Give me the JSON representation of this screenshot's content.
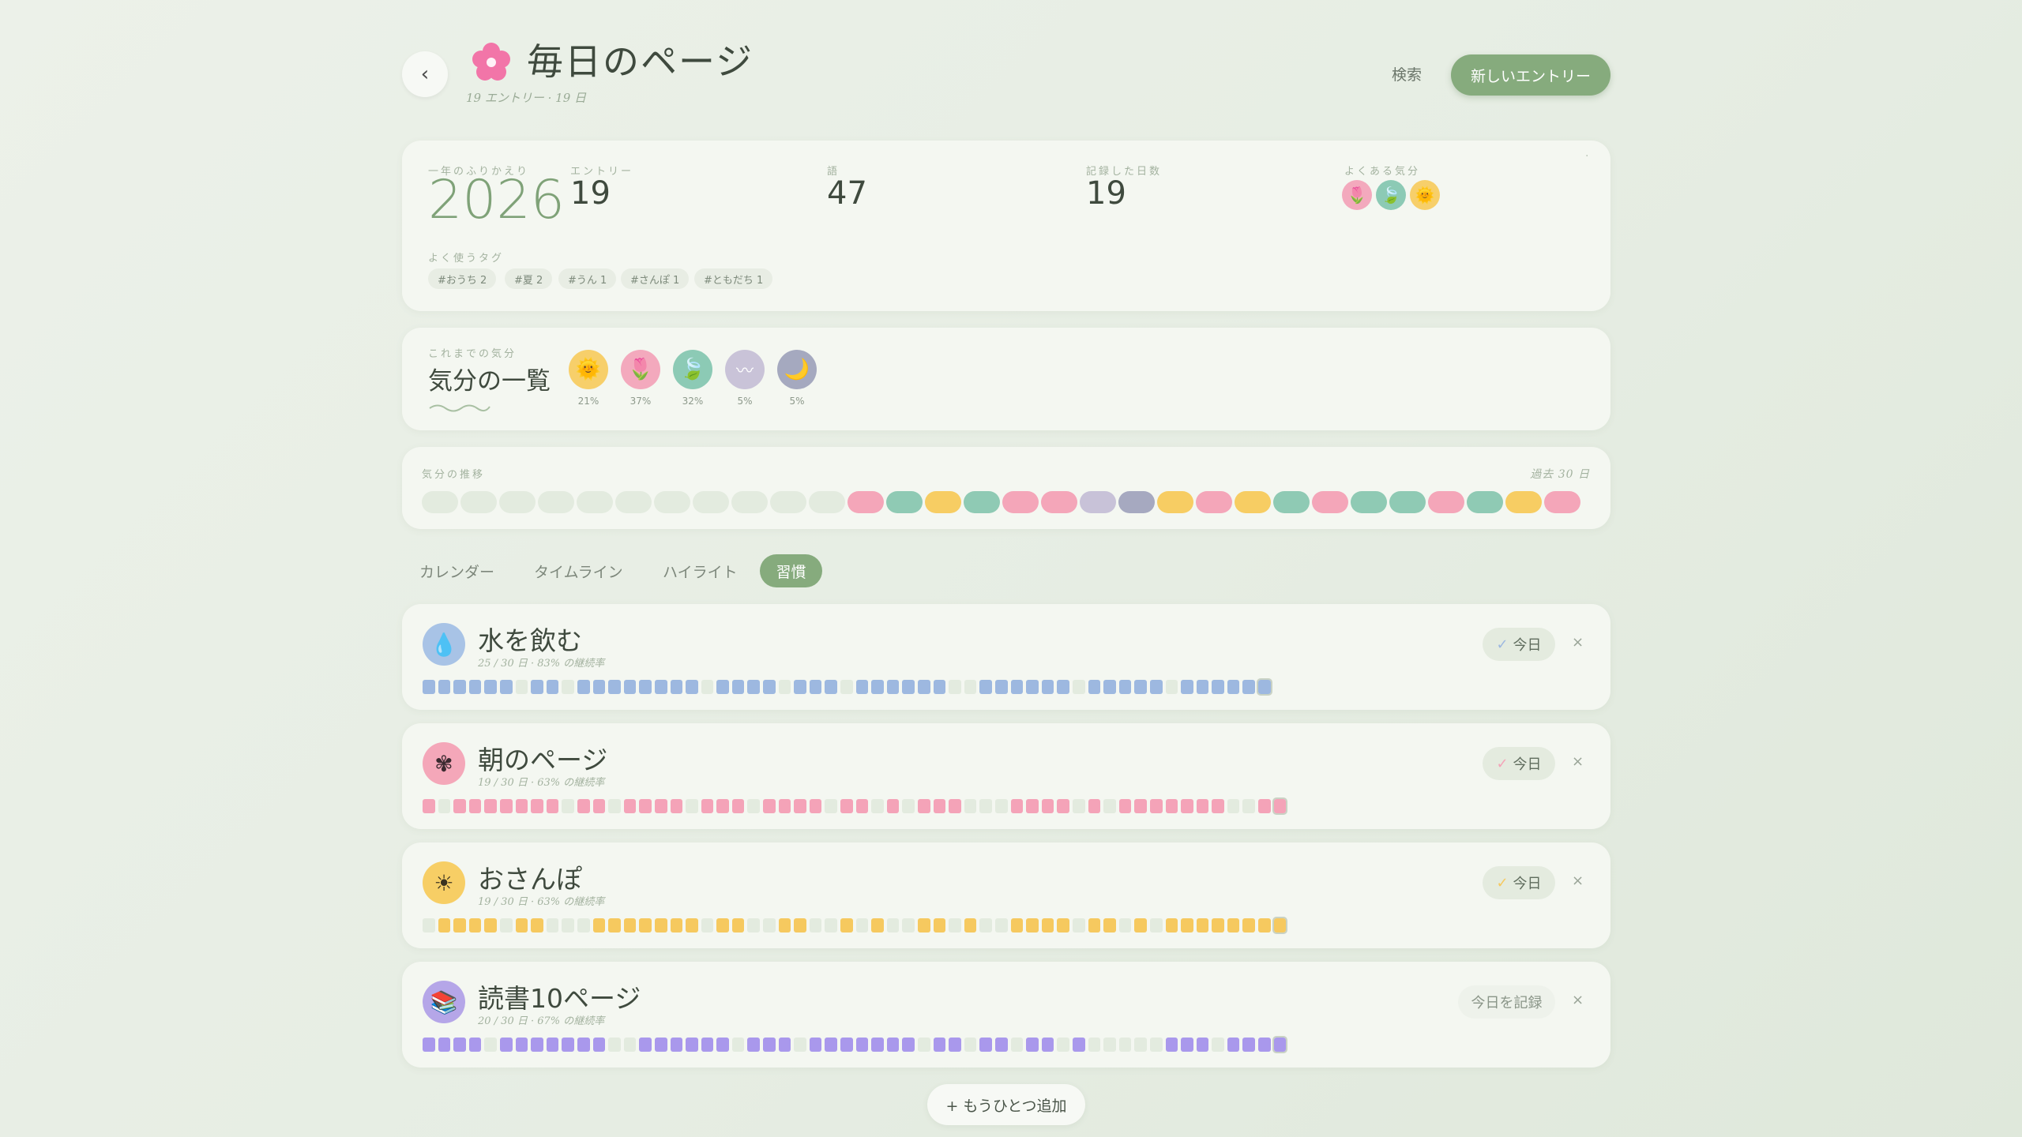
{
  "header": {
    "title": "毎日のページ",
    "subtitle": "19 エントリー · 19 日",
    "search_label": "検索",
    "new_entry_label": "新しいエントリー",
    "title_icon": "flower-icon",
    "back_icon": "chevron-left-icon"
  },
  "year_review": {
    "label": "一年のふりかえり",
    "year": "2026",
    "entries_label": "エントリー",
    "entries_value": "19",
    "words_label": "語",
    "words_value": "47",
    "days_label": "記録した日数",
    "days_value": "19",
    "common_moods_label": "よくある気分",
    "common_moods": [
      "tulip-icon",
      "leaf-icon",
      "sun-icon"
    ],
    "corner_mark": "·",
    "tags_label": "よく使うタグ",
    "tags": [
      "#おうち 2",
      "#夏 2",
      "#うん 1",
      "#さんぽ 1",
      "#ともだち 1"
    ]
  },
  "mood_overview": {
    "label": "これまでの気分",
    "title": "気分の一覧",
    "moods": [
      {
        "icon": "sun-icon",
        "glyph": "🌞",
        "pct": "21%",
        "color": "#f7cf6a"
      },
      {
        "icon": "tulip-icon",
        "glyph": "🌷",
        "pct": "37%",
        "color": "#f3a9bd"
      },
      {
        "icon": "leaf-icon",
        "glyph": "🍃",
        "pct": "32%",
        "color": "#8ccab5"
      },
      {
        "icon": "cloud-icon",
        "glyph": "〰",
        "pct": "5%",
        "color": "#c9c3d8"
      },
      {
        "icon": "moon-icon",
        "glyph": "🌙",
        "pct": "5%",
        "color": "#a5a9bf"
      }
    ]
  },
  "mood_trend": {
    "label": "気分の推移",
    "range_label": "過去 30 日",
    "days": [
      "empty",
      "empty",
      "empty",
      "empty",
      "empty",
      "empty",
      "empty",
      "empty",
      "empty",
      "empty",
      "empty",
      "pink",
      "teal",
      "yellow",
      "teal",
      "pink",
      "pink",
      "lavender",
      "slate",
      "yellow",
      "pink",
      "yellow",
      "teal",
      "pink",
      "teal",
      "teal",
      "pink",
      "teal",
      "yellow",
      "pink"
    ]
  },
  "tabs": [
    "カレンダー",
    "タイムライン",
    "ハイライト",
    "習慣"
  ],
  "active_tab": "習慣",
  "habits": [
    {
      "name": "水を飲む",
      "stat": "25 / 30 日 · 83% の継続率",
      "icon": "water-drop-icon",
      "glyph": "💧",
      "icon_bg": "#a8c3e6",
      "color": "#9db8e0",
      "button": "今日",
      "done": true,
      "days": [
        1,
        1,
        1,
        1,
        1,
        1,
        0,
        1,
        1,
        0,
        1,
        1,
        1,
        1,
        1,
        1,
        1,
        1,
        0,
        1,
        1,
        1,
        1,
        0,
        1,
        1,
        1,
        0,
        1,
        1,
        1,
        1,
        1,
        1,
        0,
        0,
        1,
        1,
        1,
        1,
        1,
        1,
        0,
        1,
        1,
        1,
        1,
        1,
        0,
        1,
        1,
        1,
        1,
        1,
        1
      ]
    },
    {
      "name": "朝のページ",
      "stat": "19 / 30 日 · 63% の継続率",
      "icon": "flower-icon",
      "glyph": "✾",
      "icon_bg": "#f4a7b9",
      "color": "#f4a3b8",
      "button": "今日",
      "done": true,
      "days": [
        1,
        0,
        1,
        1,
        1,
        1,
        1,
        1,
        1,
        0,
        1,
        1,
        0,
        1,
        1,
        1,
        1,
        0,
        1,
        1,
        1,
        0,
        1,
        1,
        1,
        1,
        0,
        1,
        1,
        0,
        1,
        0,
        1,
        1,
        1,
        0,
        0,
        0,
        1,
        1,
        1,
        1,
        0,
        1,
        0,
        1,
        1,
        1,
        1,
        1,
        1,
        1,
        0,
        0,
        1,
        1
      ]
    },
    {
      "name": "おさんぽ",
      "stat": "19 / 30 日 · 63% の継続率",
      "icon": "sun-icon",
      "glyph": "☀",
      "icon_bg": "#f7ce65",
      "color": "#f6c95f",
      "button": "今日",
      "done": true,
      "days": [
        0,
        1,
        1,
        1,
        1,
        0,
        1,
        1,
        0,
        0,
        0,
        1,
        1,
        1,
        1,
        1,
        1,
        1,
        0,
        1,
        1,
        0,
        0,
        1,
        1,
        0,
        0,
        1,
        0,
        1,
        0,
        0,
        1,
        1,
        0,
        1,
        0,
        0,
        1,
        1,
        1,
        1,
        0,
        1,
        1,
        0,
        1,
        0,
        1,
        1,
        1,
        1,
        1,
        1,
        1,
        1
      ]
    },
    {
      "name": "読書10ページ",
      "stat": "20 / 30 日 · 67% の継続率",
      "icon": "books-icon",
      "glyph": "📚",
      "icon_bg": "#b5a6e8",
      "color": "#a998ec",
      "button": "今日を記録",
      "done": false,
      "days": [
        1,
        1,
        1,
        1,
        0,
        1,
        1,
        1,
        1,
        1,
        1,
        1,
        0,
        0,
        1,
        1,
        1,
        1,
        1,
        1,
        0,
        1,
        1,
        1,
        0,
        1,
        1,
        1,
        1,
        1,
        1,
        1,
        0,
        1,
        1,
        0,
        1,
        1,
        0,
        1,
        1,
        0,
        1,
        0,
        0,
        0,
        0,
        0,
        1,
        1,
        1,
        0,
        1,
        1,
        1,
        1
      ]
    }
  ],
  "add_label": "+ もうひとつ追加",
  "colors": {
    "accent": "#86ab7d",
    "trend": {
      "empty": "#e3ebdf",
      "pink": "#f4a6b9",
      "teal": "#8fcab4",
      "yellow": "#f7cd63",
      "lavender": "#c8c2d8",
      "slate": "#a6a9c0"
    }
  }
}
